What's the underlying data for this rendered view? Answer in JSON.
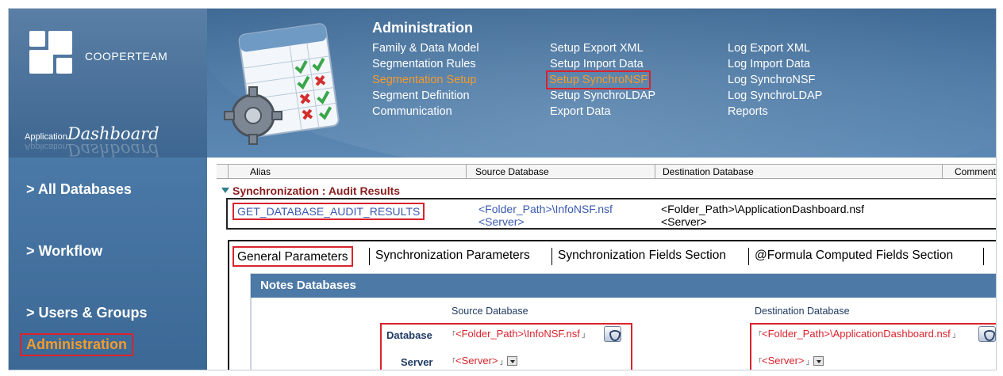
{
  "brand": {
    "logo_text": "COOPERTEAM",
    "app_prefix": "Application",
    "app_name": "Dashboard"
  },
  "admin_menu": {
    "title": "Administration",
    "col1": [
      "Family & Data Model",
      "Segmentation Rules",
      "Segmentation Setup",
      "Segment Definition",
      "Communication"
    ],
    "col2": [
      "Setup Export XML",
      "Setup Import Data",
      "Setup SynchroNSF",
      "Setup SynchroLDAP",
      "Export Data"
    ],
    "col3": [
      "Log Export XML",
      "Log Import Data",
      "Log SynchroNSF",
      "Log SynchroLDAP",
      "Reports"
    ]
  },
  "sidebar": {
    "items": [
      "> All Databases",
      "> Workflow",
      "> Users & Groups",
      "Administration"
    ]
  },
  "view": {
    "columns": [
      "Alias",
      "Source Database",
      "Destination Database",
      "Comment"
    ],
    "section_title": "Synchronization : Audit Results",
    "row": {
      "alias": "GET_DATABASE_AUDIT_RESULTS",
      "source_path": "<Folder_Path>\\InfoNSF.nsf",
      "source_server": "<Server>",
      "dest_path": "<Folder_Path>\\ApplicationDashboard.nsf",
      "dest_server": "<Server>"
    }
  },
  "form": {
    "tabs": [
      "General Parameters",
      "Synchronization Parameters",
      "Synchronization Fields Section",
      "@Formula Computed Fields Section"
    ],
    "panel_title": "Notes Databases",
    "source_header": "Source Database",
    "dest_header": "Destination Database",
    "database_label": "Database",
    "server_label": "Server",
    "source_database_value": "<Folder_Path>\\InfoNSF.nsf",
    "source_server_value": "<Server>",
    "dest_database_value": "<Folder_Path>\\ApplicationDashboard.nsf",
    "dest_server_value": "<Server>"
  },
  "colors": {
    "header_blue": "#4e7aa5",
    "accent_orange": "#f29b2e",
    "highlight_red": "#d9232d",
    "link_blue": "#3a5ab0"
  }
}
